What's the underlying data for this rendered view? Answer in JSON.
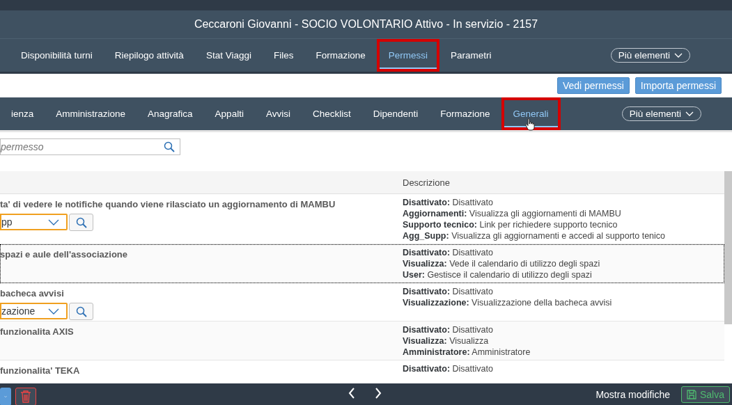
{
  "window": {
    "title": "Ceccaroni Giovanni - SOCIO VOLONTARIO Attivo - In servizio - 2157"
  },
  "tabs": [
    {
      "label": "Disponibilità turni",
      "selected": false,
      "highlighted": false
    },
    {
      "label": "Riepilogo attività",
      "selected": false,
      "highlighted": false
    },
    {
      "label": "Stat Viaggi",
      "selected": false,
      "highlighted": false
    },
    {
      "label": "Files",
      "selected": false,
      "highlighted": false
    },
    {
      "label": "Formazione",
      "selected": false,
      "highlighted": false
    },
    {
      "label": "Permessi",
      "selected": true,
      "highlighted": true
    },
    {
      "label": "Parametri",
      "selected": false,
      "highlighted": false
    }
  ],
  "tabs_more": "Più elementi",
  "actions": [
    "Vedi permessi",
    "Importa permessi"
  ],
  "subtabs": [
    {
      "label": "ienza",
      "selected": false,
      "highlighted": false
    },
    {
      "label": "Amministrazione",
      "selected": false,
      "highlighted": false
    },
    {
      "label": "Anagrafica",
      "selected": false,
      "highlighted": false
    },
    {
      "label": "Appalti",
      "selected": false,
      "highlighted": false
    },
    {
      "label": "Avvisi",
      "selected": false,
      "highlighted": false
    },
    {
      "label": "Checklist",
      "selected": false,
      "highlighted": false
    },
    {
      "label": "Dipendenti",
      "selected": false,
      "highlighted": false
    },
    {
      "label": "Formazione",
      "selected": false,
      "highlighted": false
    },
    {
      "label": "Generali",
      "selected": true,
      "highlighted": true
    }
  ],
  "subtabs_more": "Più elementi",
  "search": {
    "placeholder": "permesso"
  },
  "table": {
    "columns": [
      "Descrizione"
    ],
    "rows": [
      {
        "title": "ta' di vedere le notifiche quando viene rilasciato un aggiornamento di MAMBU",
        "value": "pp",
        "focused": false,
        "description": [
          {
            "label": "Disattivato:",
            "text": "Disattivato"
          },
          {
            "label": "Aggiornamenti:",
            "text": "Visualizza gli aggiornamenti di MAMBU"
          },
          {
            "label": "Supporto tecnico:",
            "text": "Link per richiedere supporto tecnico"
          },
          {
            "label": "Agg_Supp:",
            "text": "Visualizza gli aggiornamenti e accedi al supporto tenico"
          }
        ]
      },
      {
        "title": "spazi e aule dell'associazione",
        "focused": true,
        "description": [
          {
            "label": "Disattivato:",
            "text": "Disattivato"
          },
          {
            "label": "Visualizza:",
            "text": "Vede il calendario di utilizzo degli spazi"
          },
          {
            "label": "User:",
            "text": "Gestisce il calendario di utilizzo degli spazi"
          }
        ]
      },
      {
        "title": "bacheca avvisi",
        "value": "zazione",
        "focused": false,
        "description": [
          {
            "label": "Disattivato:",
            "text": "Disattivato"
          },
          {
            "label": "Visualizzazione:",
            "text": "Visualizzazione della bacheca avvisi"
          }
        ]
      },
      {
        "title": "funzionalita AXIS",
        "focused": false,
        "description": [
          {
            "label": "Disattivato:",
            "text": "Disattivato"
          },
          {
            "label": "Visualizza:",
            "text": "Visualizza"
          },
          {
            "label": "Amministratore:",
            "text": "Amministratore"
          }
        ]
      },
      {
        "title": "funzionalita' TEKA",
        "focused": false,
        "description": [
          {
            "label": "Disattivato:",
            "text": "Disattivato"
          }
        ]
      }
    ]
  },
  "footer": {
    "show_changes": "Mostra modifiche",
    "save": "Salva"
  }
}
